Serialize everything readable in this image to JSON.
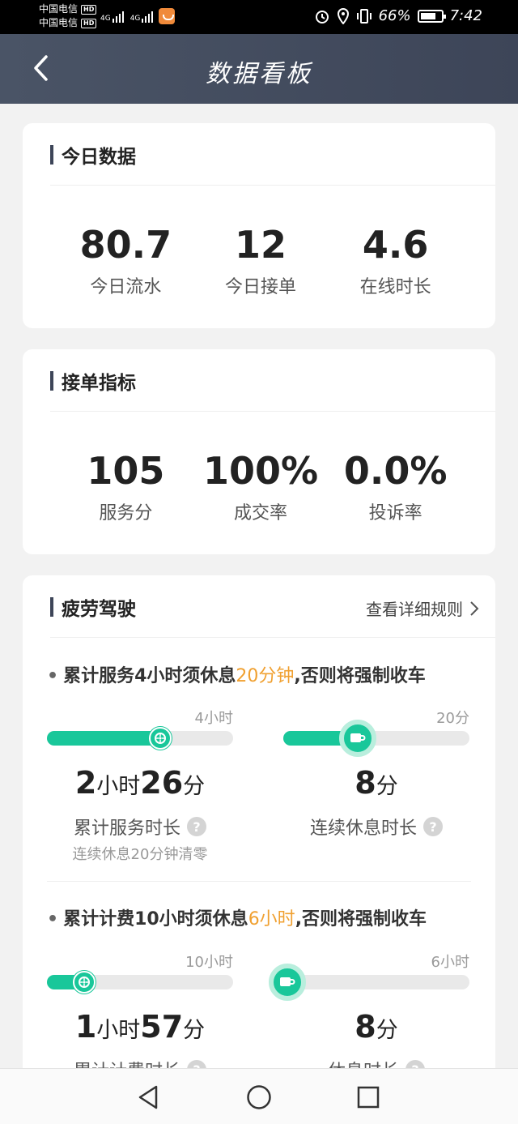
{
  "status_bar": {
    "carrier_1": "中国电信",
    "carrier_2": "中国电信",
    "hd_label": "HD",
    "net_1": "4G",
    "net_2": "4G",
    "battery": "66%",
    "time": "7:42"
  },
  "header": {
    "title": "数据看板"
  },
  "today": {
    "title": "今日数据",
    "stats": [
      {
        "value": "80.7",
        "label": "今日流水"
      },
      {
        "value": "12",
        "label": "今日接单"
      },
      {
        "value": "4.6",
        "label": "在线时长"
      }
    ]
  },
  "metrics": {
    "title": "接单指标",
    "stats": [
      {
        "value": "105",
        "label": "服务分"
      },
      {
        "value": "100%",
        "label": "成交率"
      },
      {
        "value": "0.0%",
        "label": "投诉率"
      }
    ]
  },
  "fatigue": {
    "title": "疲劳驾驶",
    "detail_link": "查看详细规则",
    "rule_1": {
      "prefix": "累计服务4小时须休息",
      "highlight": "20分钟",
      "suffix": ",否则将强制收车"
    },
    "rule_2": {
      "prefix": "累计计费10小时须休息",
      "highlight": "6小时",
      "suffix": ",否则将强制收车"
    },
    "block_1": {
      "left": {
        "max_label": "4小时",
        "progress": 0.61,
        "h": "2",
        "h_unit": "小时",
        "m": "26",
        "m_unit": "分",
        "label": "累计服务时长",
        "note": "连续休息20分钟清零"
      },
      "right": {
        "max_label": "20分",
        "progress": 0.4,
        "m": "8",
        "m_unit": "分",
        "label": "连续休息时长"
      }
    },
    "block_2": {
      "left": {
        "max_label": "10小时",
        "progress": 0.2,
        "h": "1",
        "h_unit": "小时",
        "m": "57",
        "m_unit": "分",
        "label": "累计计费时长"
      },
      "right": {
        "max_label": "6小时",
        "progress": 0.02,
        "m": "8",
        "m_unit": "分",
        "label": "休息时长"
      }
    }
  },
  "colors": {
    "accent": "#19c79a",
    "highlight": "#f0a030",
    "header": "#4a5466"
  },
  "nav": {
    "back": "back-triangle",
    "home": "home-circle",
    "recents": "recents-square"
  }
}
